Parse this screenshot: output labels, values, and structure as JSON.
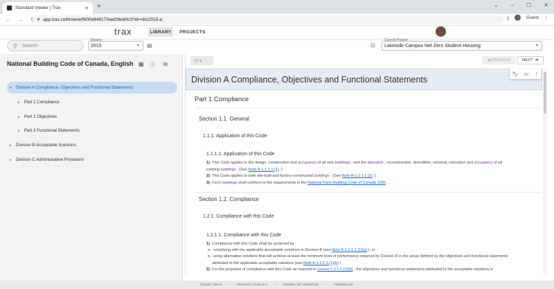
{
  "browser": {
    "tab_title": "Standard Viewer | Trax",
    "url": "app.trax.co/browse/f600d44817/bad29ed0c3?id=nbc2015-a",
    "guest_label": "Guest"
  },
  "app": {
    "logo": "trax",
    "nav": [
      "LIBRARY",
      "PROJECTS"
    ]
  },
  "toolbar": {
    "search_placeholder": "Search",
    "version_label": "Version",
    "version_value": "2015",
    "project_label": "Current Project",
    "project_value": "Lakeside Campus Net Zero Student Housing"
  },
  "sidebar": {
    "title": "National Building Code of Canada, English",
    "items": [
      {
        "label": "Division A Compliance, Objectives and Functional Statements",
        "caret": "▾",
        "selected": true
      },
      {
        "label": "Part 1 Compliance",
        "caret": "▸"
      },
      {
        "label": "Part 2 Objectives",
        "caret": "▸"
      },
      {
        "label": "Part 3 Functional Statements",
        "caret": "▸"
      },
      {
        "label": "Division B Acceptable Solutions",
        "caret": "▸"
      },
      {
        "label": "Division C Administrative Provisions",
        "caret": "▸"
      }
    ]
  },
  "content": {
    "prev_label": "PREVIOUS",
    "next_label": "NEXT",
    "division_title": "Division A Compliance, Objectives and Functional Statements",
    "part1": "Part 1 Compliance",
    "sec11": "Section 1.1. General",
    "s111": "1.1.1. Application of this Code",
    "s1111": "1.1.1.1. Application of this Code",
    "p1": {
      "num": "1)",
      "t1": "This Code applies to the design, construction and ",
      "occ": "occupancy",
      "t2": " of all new ",
      "bld": "buildings",
      "t3": " , and the ",
      "alt": "alteration",
      "t4": " , reconstruction, demolition, removal, relocation and ",
      "occ2": "occupancy",
      "t5": " of all",
      "t6": "existing ",
      "bld2": "buildings",
      "t7": " . (See ",
      "link": "Note A-1.1.1.1.(1)",
      "t8": " .)"
    },
    "p2": {
      "num": "2)",
      "t1": "This Code applies to both site-built and factory-constructed ",
      "bld": "buildings",
      "t2": " . (See ",
      "link": "Note A-1.1.1.1.(2)",
      "t3": " .)"
    },
    "p3": {
      "num": "3)",
      "farm": "Farm buildings",
      "t1": " shall conform to the requirements in the ",
      "link": "National Farm Building Code of Canada 1995",
      "t2": " ."
    },
    "sec12": "Section 1.2. Compliance",
    "s121": "1.2.1. Compliance with this Code",
    "s1211": "1.2.1.1. Compliance with this Code",
    "q1": {
      "num": "1)",
      "t": "Compliance with this Code shall be achieved by"
    },
    "qa": {
      "lbl": "a.",
      "t1": "complying with the applicable acceptable solutions in Division B (see ",
      "link": "Note A-1.2.1.1.(1)(a)",
      "t2": " ), or"
    },
    "qb": {
      "lbl": "b.",
      "t1": "using alternative solutions that will achieve at least the minimum level of performance required by Division B in the areas defined by the objectives and functional statements",
      "t2": "attributed to the applicable acceptable solutions (see ",
      "link": "Note A-1.2.1.1.(1)(b)",
      "t3": " )."
    },
    "q2": {
      "num": "2)",
      "t1": "For the purposes of compliance with this Code as required in ",
      "link": "Clause 1.2.1.1.(1)(b)",
      "t2": " , the objectives and functional statements attributed to the acceptable solutions in"
    }
  },
  "footer": [
    "©2022 TRAX",
    "PRIVACY POLICY",
    "TERMS OF SERVICE",
    "FEEDBACK"
  ]
}
